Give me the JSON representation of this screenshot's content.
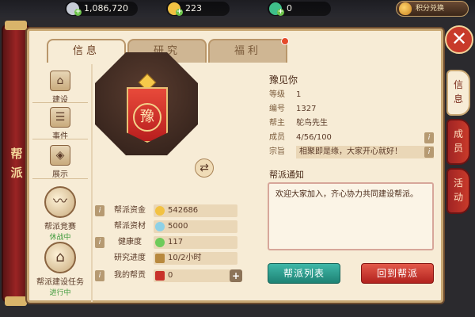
{
  "topbar": {
    "silver": "1,086,720",
    "gold": "223",
    "jade": "0",
    "exchange_label": "积分兑换",
    "colors": {
      "silver": "#c7ccd6",
      "gold": "#f2c243",
      "jade": "#3fbf8a"
    }
  },
  "tabs": [
    {
      "label": "信息",
      "active": true
    },
    {
      "label": "研究",
      "active": false
    },
    {
      "label": "福利",
      "active": false,
      "badge": true
    }
  ],
  "sidebar": {
    "title": "帮派",
    "items": [
      {
        "label": "建设",
        "icon": "pavilion-icon"
      },
      {
        "label": "事件",
        "icon": "scroll-icon"
      },
      {
        "label": "展示",
        "icon": "display-icon"
      },
      {
        "label": "帮派竞赛",
        "sub": "休战中",
        "icon": "dragon-icon"
      },
      {
        "label": "帮派建设任务",
        "sub": "进行中",
        "icon": "house-icon"
      }
    ]
  },
  "emblem": {
    "char": "豫"
  },
  "stats": [
    {
      "label": "帮派资金",
      "value": "542686",
      "icon": "coin-icon"
    },
    {
      "label": "帮派资材",
      "value": "5000",
      "icon": "material-icon"
    },
    {
      "label": "健康度",
      "value": "117",
      "icon": "health-icon"
    },
    {
      "label": "研究进度",
      "value": "10/2小时",
      "icon": "hourglass-icon"
    },
    {
      "label": "我的帮贡",
      "value": "0",
      "icon": "contribution-icon"
    }
  ],
  "info": {
    "name": "豫见你",
    "rows": [
      {
        "key": "等级",
        "value": "1"
      },
      {
        "key": "编号",
        "value": "1327"
      },
      {
        "key": "帮主",
        "value": "鸵鸟先生"
      },
      {
        "key": "成员",
        "value": "4/56/100"
      },
      {
        "key": "宗旨",
        "value": "相聚即是缘，大家开心就好！"
      }
    ],
    "notice_title": "帮派通知",
    "notice_text": "欢迎大家加入，齐心协力共同建设帮派。"
  },
  "buttons": {
    "list": "帮派列表",
    "return": "回到帮派"
  },
  "right_tabs": [
    {
      "label": "信息",
      "active": true
    },
    {
      "label": "成员",
      "active": false
    },
    {
      "label": "活动",
      "active": false
    }
  ]
}
